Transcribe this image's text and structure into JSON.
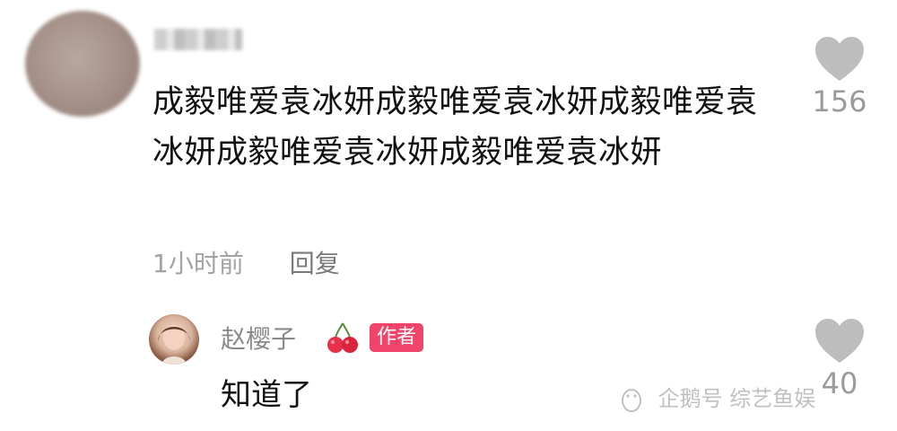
{
  "comment": {
    "text": "成毅唯爱袁冰妍成毅唯爱袁冰妍成毅唯爱袁冰妍成毅唯爱袁冰妍成毅唯爱袁冰妍",
    "time": "1小时前",
    "reply_label": "回复",
    "likes": "156"
  },
  "reply": {
    "author": "赵樱子",
    "author_emoji": "cherry-icon",
    "badge": "作者",
    "text": "知道了",
    "likes": "40"
  },
  "watermark": {
    "text": "企鹅号 综艺鱼娱"
  },
  "colors": {
    "badge": "#f0446a",
    "heart": "#bdbdbd",
    "meta_text": "#a3a3a3"
  }
}
